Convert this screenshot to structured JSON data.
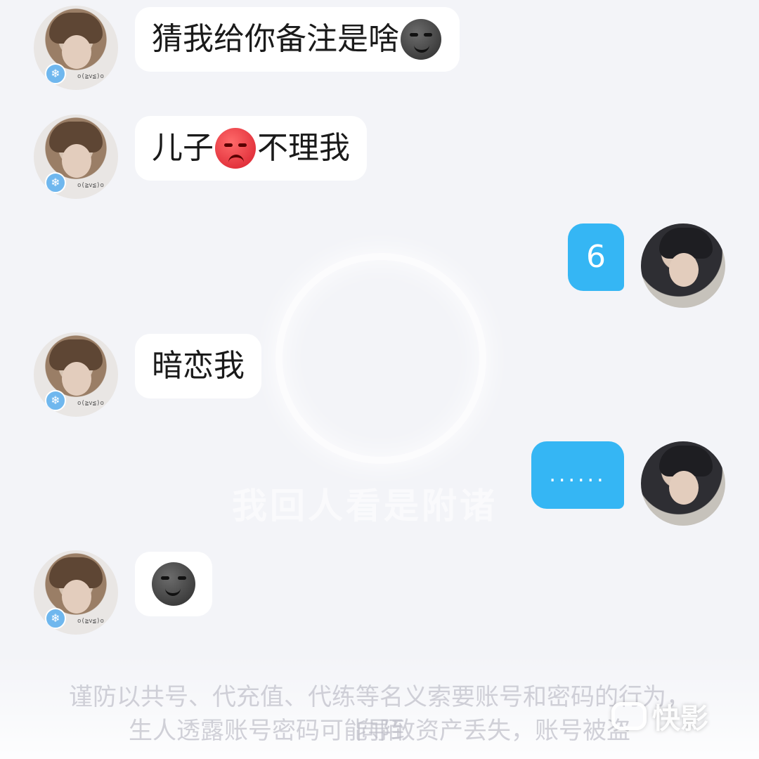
{
  "background": {
    "overlay_text": "我回人看是附诸"
  },
  "messages": [
    {
      "side": "in",
      "text": "猜我给你备注是啥",
      "trailing_emoji": "smirk-emoji"
    },
    {
      "side": "in",
      "text_before": "儿子",
      "emoji": "angry-emoji",
      "text_after": "不理我"
    },
    {
      "side": "out",
      "text": "6"
    },
    {
      "side": "in",
      "text": "暗恋我"
    },
    {
      "side": "out",
      "text": "......"
    },
    {
      "side": "in",
      "emoji_only": "smirk-emoji"
    }
  ],
  "avatars": {
    "them": {
      "badge_icon": "cold-face-icon",
      "caption": "o(≧v≦)o"
    },
    "me": {
      "badge_icon": ""
    }
  },
  "notice": {
    "line1": "谨防以共号、代充值、代练等名义索要账号和密码的行为，向陌",
    "line2": "生人透露账号密码可能导致资产丢失，账号被盗"
  },
  "watermark": {
    "label": "快影",
    "icon": "kuaiying-logo-icon"
  },
  "colors": {
    "outgoing_bubble": "#35b6f4",
    "incoming_bubble": "#ffffff",
    "background": "#f3f4f8"
  }
}
